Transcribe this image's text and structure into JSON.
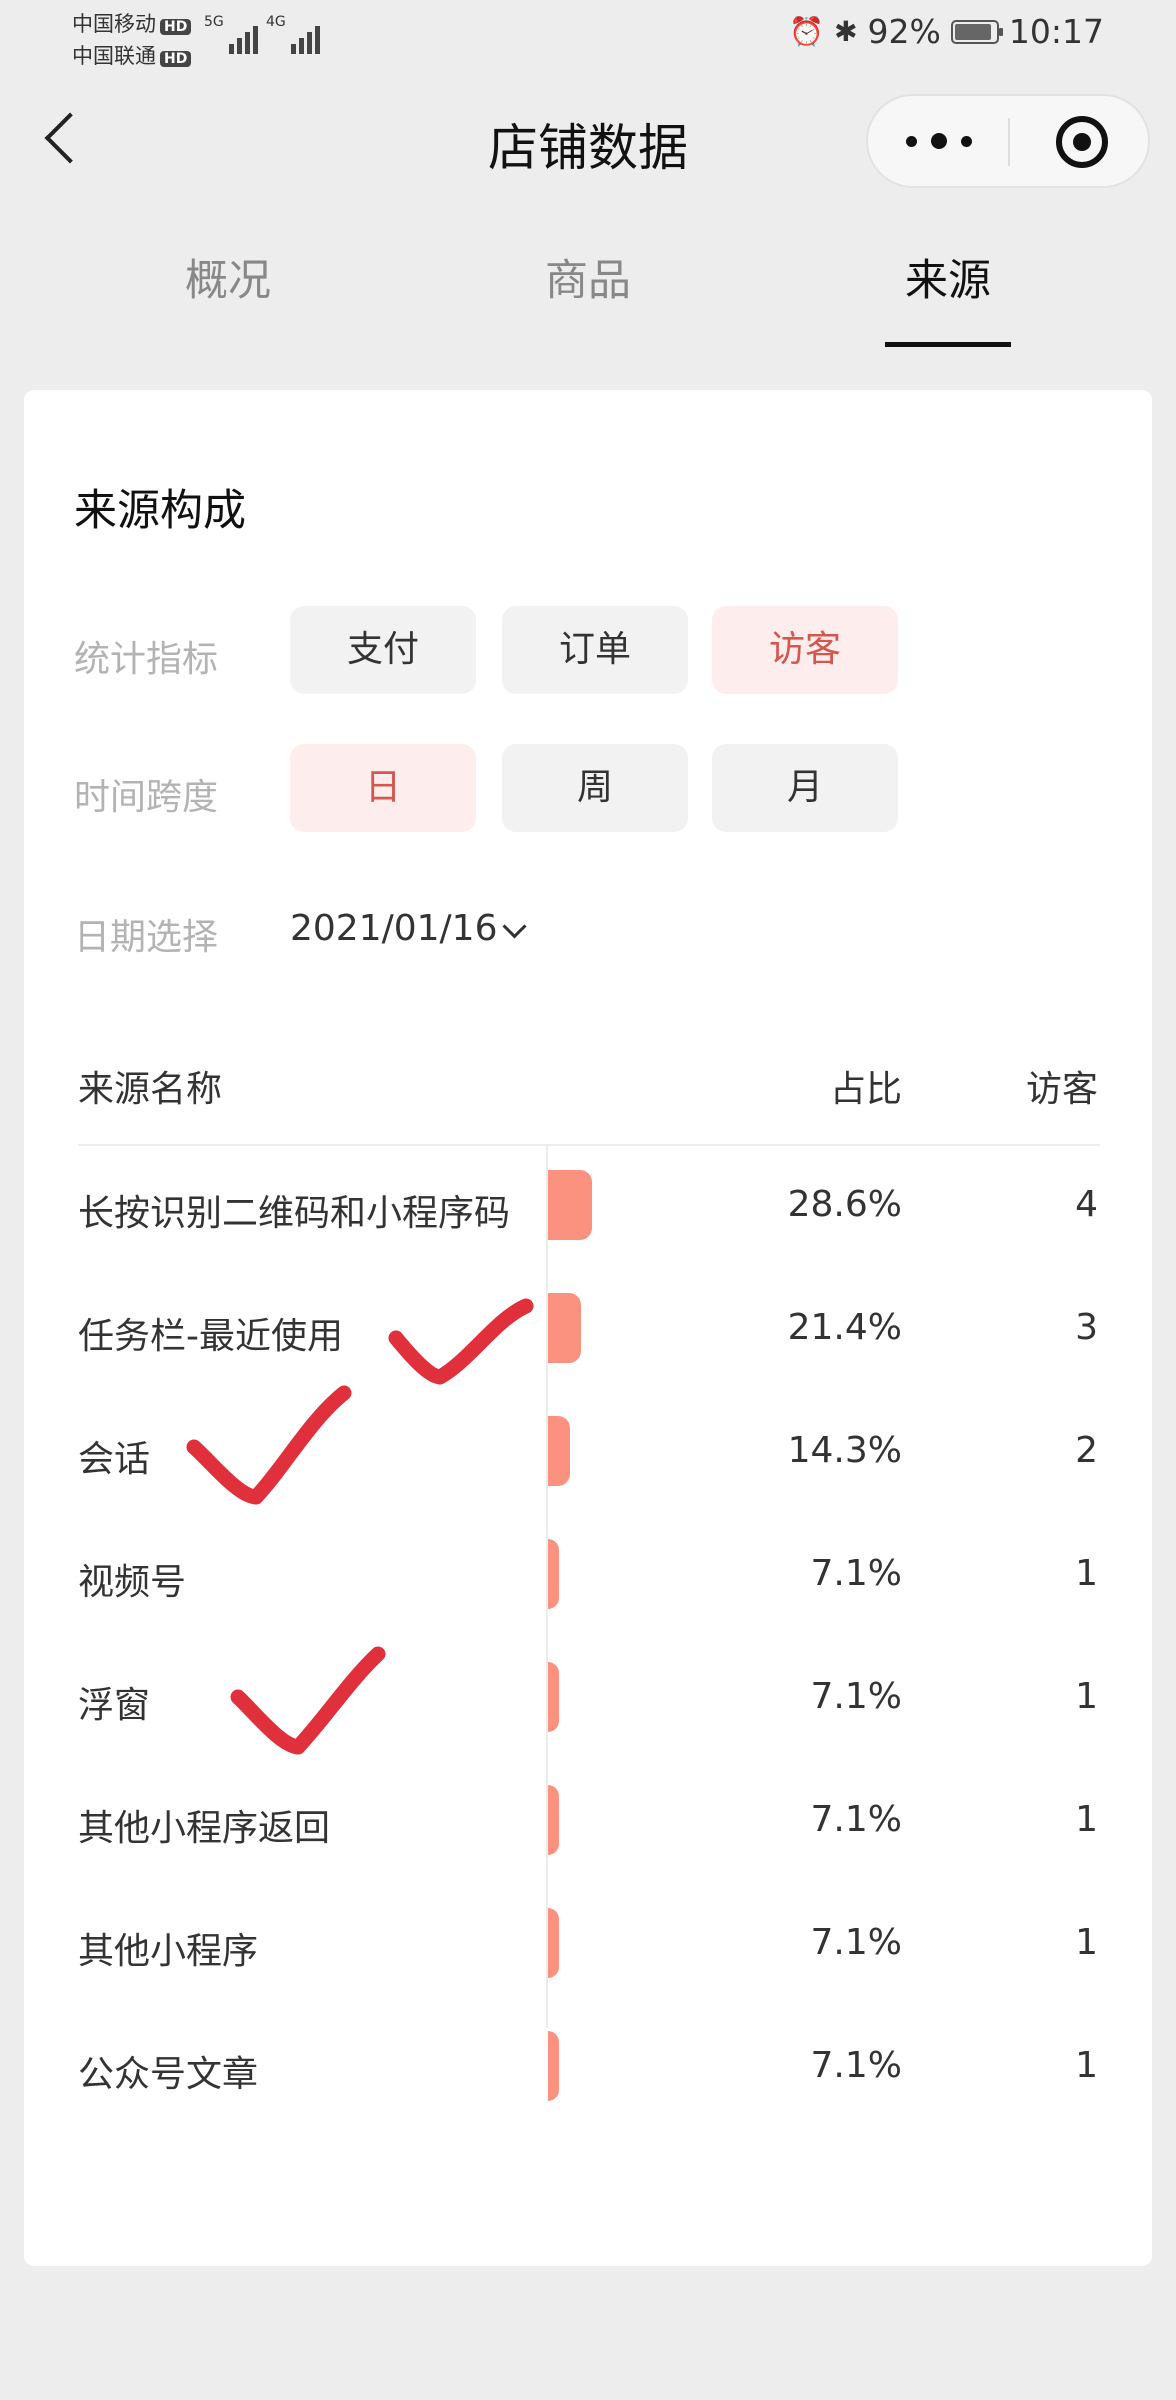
{
  "status_bar": {
    "carrier_1": "中国移动",
    "carrier_2": "中国联通",
    "hd_badge": "HD",
    "network_1": "5G",
    "network_2": "4G",
    "battery_percent": "92%",
    "time": "10:17",
    "icons": [
      "alarm-icon",
      "bluetooth-icon",
      "battery-icon"
    ]
  },
  "nav": {
    "title": "店铺数据",
    "icons": [
      "back-icon",
      "more-icon",
      "target-icon"
    ]
  },
  "tabs": [
    {
      "label": "概况",
      "active": false
    },
    {
      "label": "商品",
      "active": false
    },
    {
      "label": "来源",
      "active": true
    }
  ],
  "card": {
    "title": "来源构成",
    "filters": {
      "metric": {
        "label": "统计指标",
        "options": [
          {
            "label": "支付",
            "active": false
          },
          {
            "label": "订单",
            "active": false
          },
          {
            "label": "访客",
            "active": true
          }
        ]
      },
      "span": {
        "label": "时间跨度",
        "options": [
          {
            "label": "日",
            "active": true
          },
          {
            "label": "周",
            "active": false
          },
          {
            "label": "月",
            "active": false
          }
        ]
      },
      "date": {
        "label": "日期选择",
        "value": "2021/01/16"
      }
    },
    "table": {
      "headers": {
        "name": "来源名称",
        "share": "占比",
        "visitors": "访客"
      },
      "rows": [
        {
          "name": "长按识别二维码和小程序码",
          "share_text": "28.6%",
          "share": 28.6,
          "visitors": "4"
        },
        {
          "name": "任务栏-最近使用",
          "share_text": "21.4%",
          "share": 21.4,
          "visitors": "3"
        },
        {
          "name": "会话",
          "share_text": "14.3%",
          "share": 14.3,
          "visitors": "2"
        },
        {
          "name": "视频号",
          "share_text": "7.1%",
          "share": 7.1,
          "visitors": "1"
        },
        {
          "name": "浮窗",
          "share_text": "7.1%",
          "share": 7.1,
          "visitors": "1"
        },
        {
          "name": "其他小程序返回",
          "share_text": "7.1%",
          "share": 7.1,
          "visitors": "1"
        },
        {
          "name": "其他小程序",
          "share_text": "7.1%",
          "share": 7.1,
          "visitors": "1"
        },
        {
          "name": "公众号文章",
          "share_text": "7.1%",
          "share": 7.1,
          "visitors": "1"
        }
      ]
    }
  },
  "colors": {
    "accent": "#d4564f",
    "bar": "#fb9280",
    "chip_active_bg": "#fdeeed",
    "annotation": "#e0303c"
  }
}
